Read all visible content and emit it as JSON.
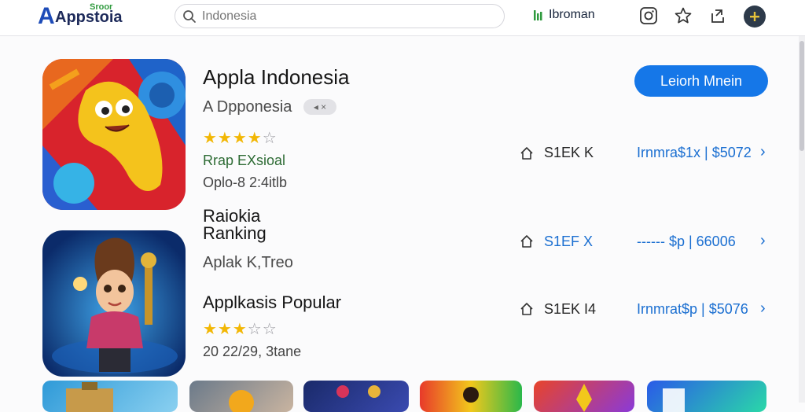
{
  "header": {
    "logo_mark": "A",
    "logo_text": "Appstoia",
    "logo_sup": "Sroor",
    "search_placeholder": "Indonesia",
    "user_name": "Ibroman",
    "icons": [
      "instagram-icon",
      "star-outline-icon",
      "share-icon",
      "user-avatar-icon"
    ]
  },
  "apps": [
    {
      "title": "Appla Indonesia",
      "subtitle": "A Dpponesia",
      "badge": "◂ ×",
      "stars_on": "★★★★",
      "stars_off": "☆",
      "category": "Rrap EXsioal",
      "date": "Oplo-8 2:4itlb",
      "cta": "Leiorh Mnein",
      "downloads": "S1EK K",
      "price": "Irnmra$1x | $5072",
      "chevron": "›"
    },
    {
      "title_line1": "Raiokia",
      "title_line2": "Ranking",
      "subtitle": "Aplak K,Treo",
      "downloads": "S1EF X",
      "price": "------ $p | 66006",
      "chevron": "›"
    },
    {
      "title": "Applkasis Popular",
      "stars_on": "★★★",
      "stars_off": "☆☆",
      "date": "20 22/29, 3tane",
      "downloads": "S1EK I4",
      "price": "Irnmrat$p | $5076",
      "chevron": "›"
    }
  ],
  "colors": {
    "accent": "#1577e8",
    "link": "#1b6fd1",
    "star": "#f2b705"
  }
}
